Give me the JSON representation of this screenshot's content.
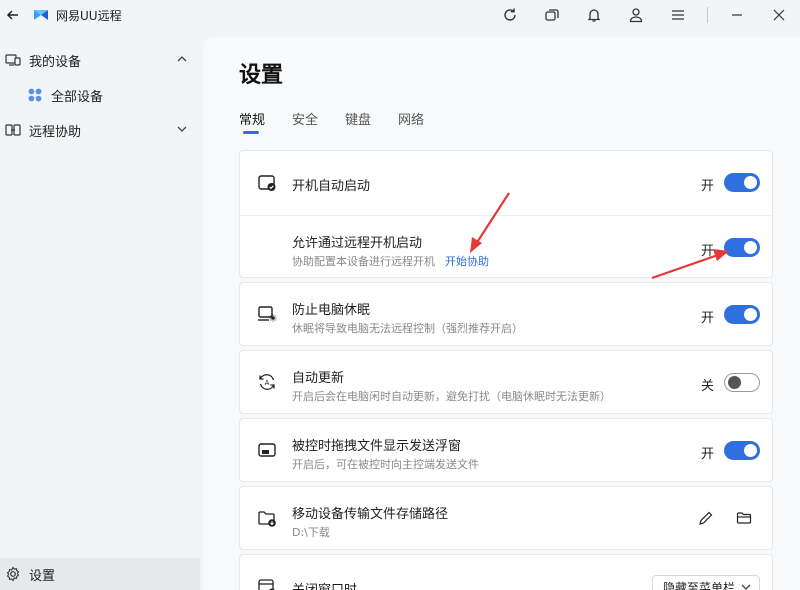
{
  "window": {
    "title": "网易UU远程"
  },
  "sidebar": {
    "items": [
      {
        "label": "我的设备"
      },
      {
        "label": "全部设备"
      },
      {
        "label": "远程协助"
      },
      {
        "label": "设置"
      }
    ]
  },
  "main": {
    "title": "设置",
    "tabs": [
      {
        "label": "常规"
      },
      {
        "label": "安全"
      },
      {
        "label": "键盘"
      },
      {
        "label": "网络"
      }
    ],
    "settings": {
      "auto_start": {
        "title": "开机自动启动",
        "state": "开",
        "on": true
      },
      "remote_boot": {
        "title": "允许通过远程开机启动",
        "desc": "协助配置本设备进行远程开机",
        "link": "开始协助",
        "state": "开",
        "on": true
      },
      "prevent_sleep": {
        "title": "防止电脑休眠",
        "desc": "休眠将导致电脑无法远程控制（强烈推荐开启）",
        "state": "开",
        "on": true
      },
      "auto_update": {
        "title": "自动更新",
        "desc": "开启后会在电脑闲时自动更新，避免打扰（电脑休眠时无法更新）",
        "state": "关",
        "on": false
      },
      "float_window": {
        "title": "被控时拖拽文件显示发送浮窗",
        "desc": "开启后，可在被控时向主控端发送文件",
        "state": "开",
        "on": true
      },
      "mobile_path": {
        "title": "移动设备传输文件存储路径",
        "desc": "D:\\下载"
      },
      "close_window": {
        "title": "关闭窗口时",
        "selected": "隐藏至菜单栏"
      }
    }
  },
  "colors": {
    "accent": "#2f6fe0",
    "annotation_arrow": "#e53935"
  }
}
